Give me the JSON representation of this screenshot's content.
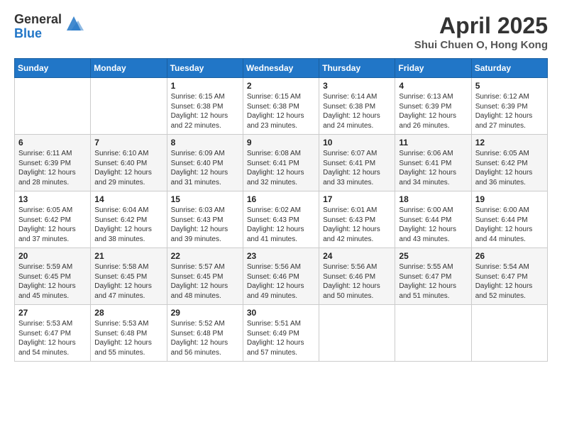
{
  "logo": {
    "general": "General",
    "blue": "Blue"
  },
  "header": {
    "title": "April 2025",
    "subtitle": "Shui Chuen O, Hong Kong"
  },
  "days_of_week": [
    "Sunday",
    "Monday",
    "Tuesday",
    "Wednesday",
    "Thursday",
    "Friday",
    "Saturday"
  ],
  "weeks": [
    [
      {
        "day": "",
        "info": ""
      },
      {
        "day": "",
        "info": ""
      },
      {
        "day": "1",
        "info": "Sunrise: 6:15 AM\nSunset: 6:38 PM\nDaylight: 12 hours and 22 minutes."
      },
      {
        "day": "2",
        "info": "Sunrise: 6:15 AM\nSunset: 6:38 PM\nDaylight: 12 hours and 23 minutes."
      },
      {
        "day": "3",
        "info": "Sunrise: 6:14 AM\nSunset: 6:38 PM\nDaylight: 12 hours and 24 minutes."
      },
      {
        "day": "4",
        "info": "Sunrise: 6:13 AM\nSunset: 6:39 PM\nDaylight: 12 hours and 26 minutes."
      },
      {
        "day": "5",
        "info": "Sunrise: 6:12 AM\nSunset: 6:39 PM\nDaylight: 12 hours and 27 minutes."
      }
    ],
    [
      {
        "day": "6",
        "info": "Sunrise: 6:11 AM\nSunset: 6:39 PM\nDaylight: 12 hours and 28 minutes."
      },
      {
        "day": "7",
        "info": "Sunrise: 6:10 AM\nSunset: 6:40 PM\nDaylight: 12 hours and 29 minutes."
      },
      {
        "day": "8",
        "info": "Sunrise: 6:09 AM\nSunset: 6:40 PM\nDaylight: 12 hours and 31 minutes."
      },
      {
        "day": "9",
        "info": "Sunrise: 6:08 AM\nSunset: 6:41 PM\nDaylight: 12 hours and 32 minutes."
      },
      {
        "day": "10",
        "info": "Sunrise: 6:07 AM\nSunset: 6:41 PM\nDaylight: 12 hours and 33 minutes."
      },
      {
        "day": "11",
        "info": "Sunrise: 6:06 AM\nSunset: 6:41 PM\nDaylight: 12 hours and 34 minutes."
      },
      {
        "day": "12",
        "info": "Sunrise: 6:05 AM\nSunset: 6:42 PM\nDaylight: 12 hours and 36 minutes."
      }
    ],
    [
      {
        "day": "13",
        "info": "Sunrise: 6:05 AM\nSunset: 6:42 PM\nDaylight: 12 hours and 37 minutes."
      },
      {
        "day": "14",
        "info": "Sunrise: 6:04 AM\nSunset: 6:42 PM\nDaylight: 12 hours and 38 minutes."
      },
      {
        "day": "15",
        "info": "Sunrise: 6:03 AM\nSunset: 6:43 PM\nDaylight: 12 hours and 39 minutes."
      },
      {
        "day": "16",
        "info": "Sunrise: 6:02 AM\nSunset: 6:43 PM\nDaylight: 12 hours and 41 minutes."
      },
      {
        "day": "17",
        "info": "Sunrise: 6:01 AM\nSunset: 6:43 PM\nDaylight: 12 hours and 42 minutes."
      },
      {
        "day": "18",
        "info": "Sunrise: 6:00 AM\nSunset: 6:44 PM\nDaylight: 12 hours and 43 minutes."
      },
      {
        "day": "19",
        "info": "Sunrise: 6:00 AM\nSunset: 6:44 PM\nDaylight: 12 hours and 44 minutes."
      }
    ],
    [
      {
        "day": "20",
        "info": "Sunrise: 5:59 AM\nSunset: 6:45 PM\nDaylight: 12 hours and 45 minutes."
      },
      {
        "day": "21",
        "info": "Sunrise: 5:58 AM\nSunset: 6:45 PM\nDaylight: 12 hours and 47 minutes."
      },
      {
        "day": "22",
        "info": "Sunrise: 5:57 AM\nSunset: 6:45 PM\nDaylight: 12 hours and 48 minutes."
      },
      {
        "day": "23",
        "info": "Sunrise: 5:56 AM\nSunset: 6:46 PM\nDaylight: 12 hours and 49 minutes."
      },
      {
        "day": "24",
        "info": "Sunrise: 5:56 AM\nSunset: 6:46 PM\nDaylight: 12 hours and 50 minutes."
      },
      {
        "day": "25",
        "info": "Sunrise: 5:55 AM\nSunset: 6:47 PM\nDaylight: 12 hours and 51 minutes."
      },
      {
        "day": "26",
        "info": "Sunrise: 5:54 AM\nSunset: 6:47 PM\nDaylight: 12 hours and 52 minutes."
      }
    ],
    [
      {
        "day": "27",
        "info": "Sunrise: 5:53 AM\nSunset: 6:47 PM\nDaylight: 12 hours and 54 minutes."
      },
      {
        "day": "28",
        "info": "Sunrise: 5:53 AM\nSunset: 6:48 PM\nDaylight: 12 hours and 55 minutes."
      },
      {
        "day": "29",
        "info": "Sunrise: 5:52 AM\nSunset: 6:48 PM\nDaylight: 12 hours and 56 minutes."
      },
      {
        "day": "30",
        "info": "Sunrise: 5:51 AM\nSunset: 6:49 PM\nDaylight: 12 hours and 57 minutes."
      },
      {
        "day": "",
        "info": ""
      },
      {
        "day": "",
        "info": ""
      },
      {
        "day": "",
        "info": ""
      }
    ]
  ]
}
